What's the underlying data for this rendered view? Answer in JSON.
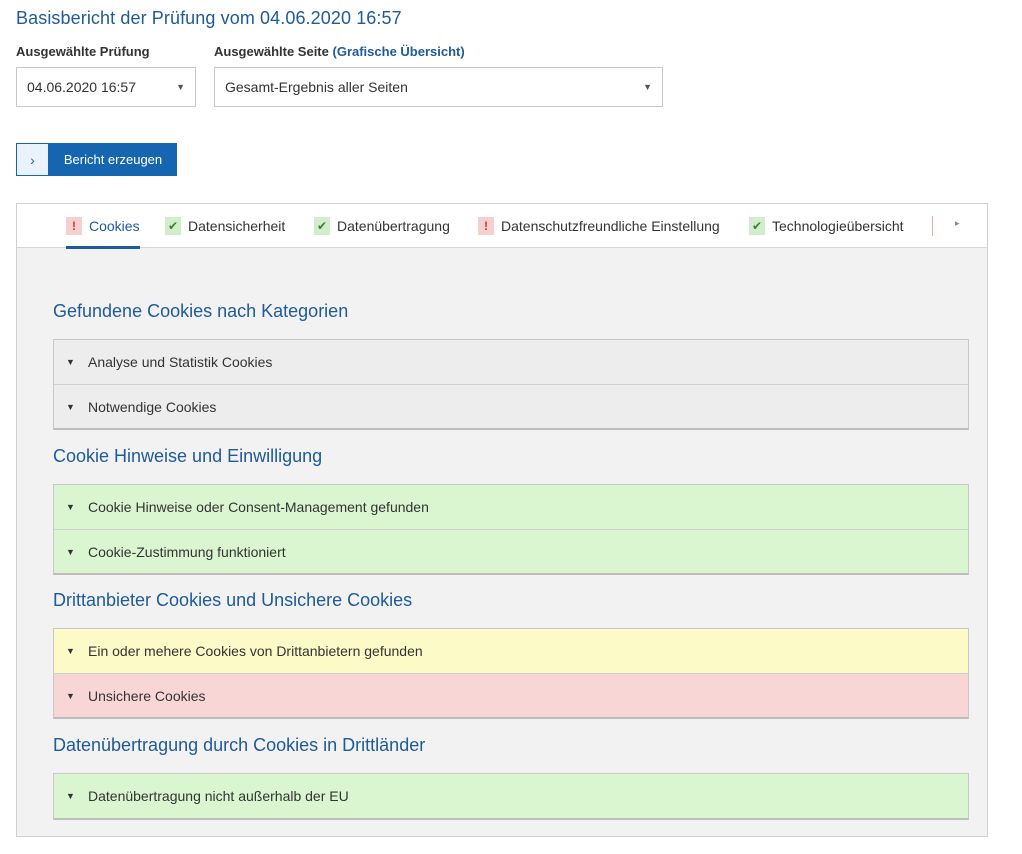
{
  "page_title": "Basisbericht der Prüfung vom 04.06.2020 16:57",
  "filters": {
    "pruefung_label": "Ausgewählte Prüfung",
    "pruefung_value": "04.06.2020 16:57",
    "seite_label": "Ausgewählte Seite",
    "seite_link": "(Grafische Übersicht)",
    "seite_value": "Gesamt-Ergebnis aller Seiten"
  },
  "report_button": {
    "arrow": "›",
    "label": "Bericht erzeugen"
  },
  "tabs": [
    {
      "label": "Cookies",
      "status": "warn",
      "icon": "!"
    },
    {
      "label": "Datensicherheit",
      "status": "ok",
      "icon": "✔"
    },
    {
      "label": "Datenübertragung",
      "status": "ok",
      "icon": "✔"
    },
    {
      "label": "Datenschutzfreundliche Einstellung",
      "status": "warn",
      "icon": "!"
    },
    {
      "label": "Technologieübersicht",
      "status": "ok",
      "icon": "✔"
    }
  ],
  "tab_next_icon": "▸",
  "sections": [
    {
      "title": "Gefundene Cookies nach Kategorien",
      "rows": [
        {
          "label": "Analyse und Statistik Cookies",
          "status": "neutral"
        },
        {
          "label": "Notwendige Cookies",
          "status": "neutral"
        }
      ]
    },
    {
      "title": "Cookie Hinweise und Einwilligung",
      "rows": [
        {
          "label": "Cookie Hinweise oder Consent-Management gefunden",
          "status": "ok"
        },
        {
          "label": "Cookie-Zustimmung funktioniert",
          "status": "ok"
        }
      ]
    },
    {
      "title": "Drittanbieter Cookies und Unsichere Cookies",
      "rows": [
        {
          "label": "Ein oder mehere Cookies von Drittanbietern gefunden",
          "status": "warning"
        },
        {
          "label": "Unsichere Cookies",
          "status": "error"
        }
      ]
    },
    {
      "title": "Datenübertragung durch Cookies in Drittländer",
      "rows": [
        {
          "label": "Datenübertragung nicht außerhalb der EU",
          "status": "ok"
        }
      ]
    }
  ],
  "row_toggle_icon": "▼",
  "select_caret_icon": "▼",
  "colors": {
    "accent": "#1f5a99",
    "button": "#1565b0",
    "ok": "#d9f6d0",
    "warning": "#fcfbc8",
    "error": "#f9d6d6",
    "neutral": "#ededed"
  }
}
